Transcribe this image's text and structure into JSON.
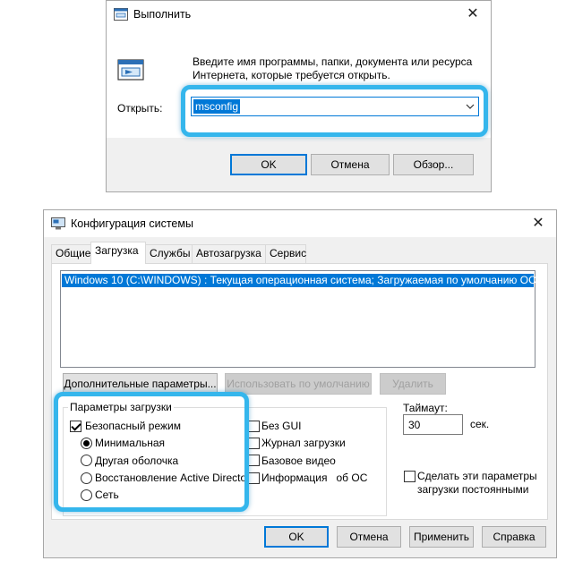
{
  "run_dialog": {
    "title": "Выполнить",
    "description_line1": "Введите имя программы, папки, документа или ресурса",
    "description_line2": "Интернета, которые требуется открыть.",
    "open_label": "Открыть:",
    "open_value": "msconfig",
    "ok_label": "OK",
    "cancel_label": "Отмена",
    "browse_label": "Обзор...",
    "close_glyph": "✕"
  },
  "sysconfig": {
    "title": "Конфигурация системы",
    "close_glyph": "✕",
    "tabs": [
      "Общие",
      "Загрузка",
      "Службы",
      "Автозагрузка",
      "Сервис"
    ],
    "active_tab": "Загрузка",
    "boot_entries": [
      "Windows 10 (C:\\WINDOWS) : Текущая операционная система; Загружаемая по умолчанию ОС"
    ],
    "advanced_button": "Дополнительные параметры...",
    "default_button": "Использовать по умолчанию",
    "delete_button": "Удалить",
    "boot_options": {
      "group_label": "Параметры загрузки",
      "safe_mode_label": "Безопасный режим",
      "safe_mode_checked": true,
      "minimal_label": "Минимальная",
      "alt_shell_label": "Другая оболочка",
      "ad_repair_label": "Восстановление Active Directory",
      "network_label": "Сеть",
      "selected_mode": "Минимальная",
      "no_gui_label": "Без GUI",
      "boot_log_label": "Журнал загрузки",
      "base_video_label": "Базовое видео",
      "os_info_label": "Информация   об ОС"
    },
    "timeout_label": "Таймаут:",
    "timeout_value": "30",
    "timeout_unit": "сек.",
    "permanent_label_line1": "Сделать эти параметры",
    "permanent_label_line2": "загрузки постоянными",
    "ok_label": "OK",
    "cancel_label": "Отмена",
    "apply_label": "Применить",
    "help_label": "Справка"
  },
  "colors": {
    "highlight": "#35b6ec",
    "selection": "#0078d7",
    "button_face": "#e1e1e1"
  },
  "icons": {
    "run_icon": "run-dialog-icon",
    "sysconfig_icon": "msconfig-icon",
    "dropdown": "chevron-down-icon"
  }
}
